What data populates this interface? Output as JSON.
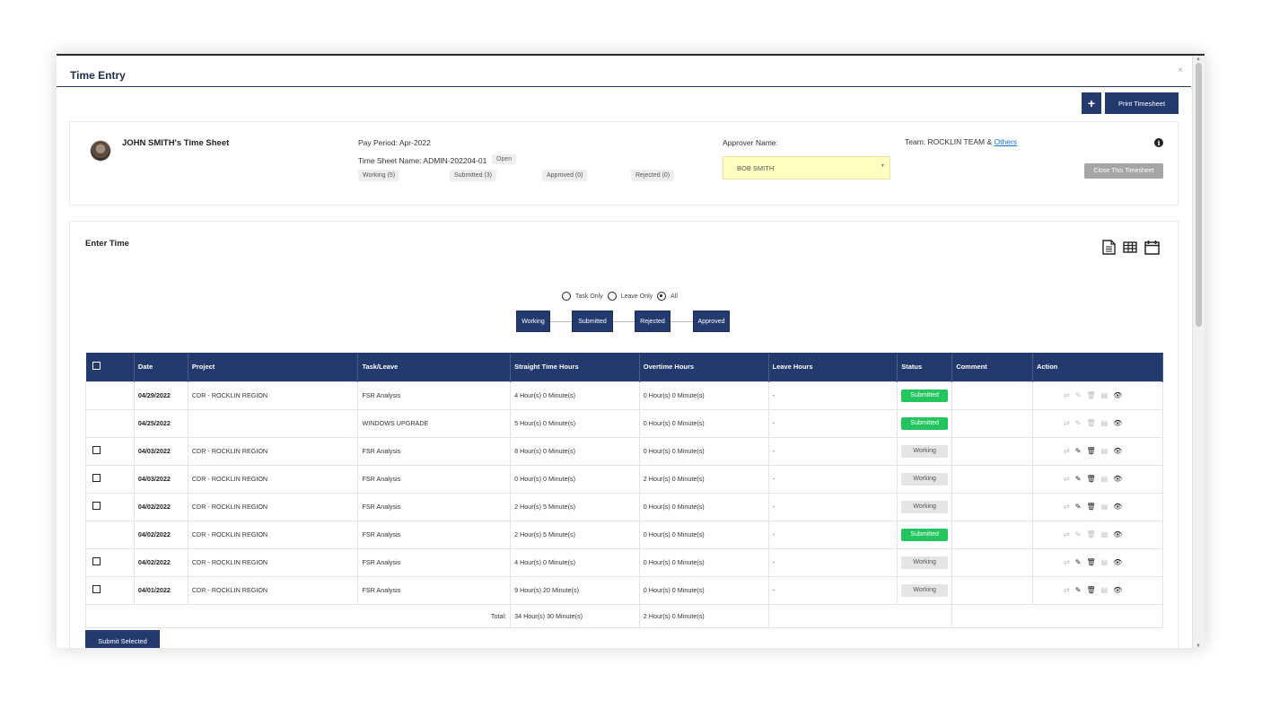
{
  "window": {
    "title": "Time Entry",
    "close": "×"
  },
  "toolbar": {
    "add_label": "+",
    "print_label": "Print Timesheet"
  },
  "sheet": {
    "owner": "JOHN SMITH's Time Sheet",
    "pay_period": "Pay Period: Apr-2022",
    "name": "Time Sheet Name: ADMIN-202204-01",
    "open_badge": "Open",
    "counts": [
      "Working (5)",
      "Submitted (3)",
      "Approved (0)",
      "Rejected (0)"
    ],
    "approver_label": "Approver Name:",
    "approver_value": "BOB SMITH",
    "team_prefix": "Team: ROCKLIN TEAM & ",
    "team_link": "Others",
    "info_icon": "i",
    "close_button": "Close This Timesheet"
  },
  "enter_time": {
    "title": "Enter Time",
    "view_icons": [
      "document-icon",
      "table-icon",
      "calendar-icon"
    ],
    "filters": [
      {
        "label": "Task Only",
        "selected": false
      },
      {
        "label": "Leave Only",
        "selected": false
      },
      {
        "label": "All",
        "selected": true
      }
    ],
    "flow": [
      "Working",
      "Submitted",
      "Rejected",
      "Approved"
    ]
  },
  "table": {
    "headers": [
      "Date",
      "Project",
      "Task/Leave",
      "Straight Time Hours",
      "Overtime Hours",
      "Leave Hours",
      "Status",
      "Comment",
      "Action"
    ],
    "rows": [
      {
        "checkbox": false,
        "date": "04/29/2022",
        "project": "CDR - ROCKLIN REGION",
        "task": "FSR Analysis",
        "straight": "4 Hour(s) 0 Minute(s)",
        "overtime": "0 Hour(s) 0 Minute(s)",
        "leave": "-",
        "status": "Submitted",
        "comment": ""
      },
      {
        "checkbox": false,
        "date": "04/25/2022",
        "project": "",
        "task": "WINDOWS UPGRADE",
        "straight": "5 Hour(s) 0 Minute(s)",
        "overtime": "0 Hour(s) 0 Minute(s)",
        "leave": "-",
        "status": "Submitted",
        "comment": ""
      },
      {
        "checkbox": true,
        "date": "04/03/2022",
        "project": "CDR - ROCKLIN REGION",
        "task": "FSR Analysis",
        "straight": "8 Hour(s) 0 Minute(s)",
        "overtime": "0 Hour(s) 0 Minute(s)",
        "leave": "-",
        "status": "Working",
        "comment": ""
      },
      {
        "checkbox": true,
        "date": "04/03/2022",
        "project": "CDR - ROCKLIN REGION",
        "task": "FSR Analysis",
        "straight": "0 Hour(s) 0 Minute(s)",
        "overtime": "2 Hour(s) 0 Minute(s)",
        "leave": "-",
        "status": "Working",
        "comment": ""
      },
      {
        "checkbox": true,
        "date": "04/02/2022",
        "project": "CDR - ROCKLIN REGION",
        "task": "FSR Analysis",
        "straight": "2 Hour(s) 5 Minute(s)",
        "overtime": "0 Hour(s) 0 Minute(s)",
        "leave": "-",
        "status": "Working",
        "comment": ""
      },
      {
        "checkbox": false,
        "date": "04/02/2022",
        "project": "CDR - ROCKLIN REGION",
        "task": "FSR Analysis",
        "straight": "2 Hour(s) 5 Minute(s)",
        "overtime": "0 Hour(s) 0 Minute(s)",
        "leave": "-",
        "status": "Submitted",
        "comment": ""
      },
      {
        "checkbox": true,
        "date": "04/02/2022",
        "project": "CDR - ROCKLIN REGION",
        "task": "FSR Analysis",
        "straight": "4 Hour(s) 0 Minute(s)",
        "overtime": "0 Hour(s) 0 Minute(s)",
        "leave": "-",
        "status": "Working",
        "comment": ""
      },
      {
        "checkbox": true,
        "date": "04/01/2022",
        "project": "CDR - ROCKLIN REGION",
        "task": "FSR Analysis",
        "straight": "9 Hour(s) 20 Minute(s)",
        "overtime": "0 Hour(s) 0 Minute(s)",
        "leave": "-",
        "status": "Working",
        "comment": ""
      }
    ],
    "total_label": "Total:",
    "total_straight": "34 Hour(s) 30 Minute(s)",
    "total_overtime": "2 Hour(s) 0 Minute(s)",
    "action_icons": [
      "transfer-icon",
      "edit-icon",
      "delete-icon",
      "note-icon",
      "view-icon"
    ]
  },
  "submit_label": "Submit Selected",
  "colors": {
    "primary": "#233a6e",
    "submitted": "#22c55e",
    "working": "#e5e5e5",
    "approver_bg": "#ffffc2",
    "link": "#1a73c8"
  }
}
